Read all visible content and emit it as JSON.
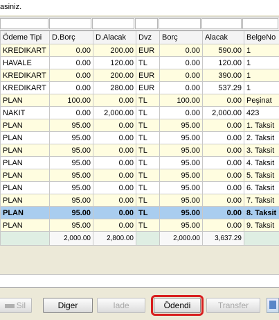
{
  "hint_text": "asiniz.",
  "columns": [
    "Ödeme Tipi",
    "D.Borç",
    "D.Alacak",
    "Dvz",
    "Borç",
    "Alacak",
    "BelgeNo"
  ],
  "rows": [
    {
      "tip": "KREDIKART",
      "dborc": "0.00",
      "dalacak": "200.00",
      "dvz": "EUR",
      "borc": "0.00",
      "alacak": "590.00",
      "belge": "1",
      "style": "y"
    },
    {
      "tip": "HAVALE",
      "dborc": "0.00",
      "dalacak": "120.00",
      "dvz": "TL",
      "borc": "0.00",
      "alacak": "120.00",
      "belge": "1",
      "style": "w"
    },
    {
      "tip": "KREDIKART",
      "dborc": "0.00",
      "dalacak": "200.00",
      "dvz": "EUR",
      "borc": "0.00",
      "alacak": "390.00",
      "belge": "1",
      "style": "y"
    },
    {
      "tip": "KREDIKART",
      "dborc": "0.00",
      "dalacak": "280.00",
      "dvz": "EUR",
      "borc": "0.00",
      "alacak": "537.29",
      "belge": "1",
      "style": "w"
    },
    {
      "tip": "PLAN",
      "dborc": "100.00",
      "dalacak": "0.00",
      "dvz": "TL",
      "borc": "100.00",
      "alacak": "0.00",
      "belge": "Peşinat",
      "style": "y"
    },
    {
      "tip": "NAKIT",
      "dborc": "0.00",
      "dalacak": "2,000.00",
      "dvz": "TL",
      "borc": "0.00",
      "alacak": "2,000.00",
      "belge": "423",
      "style": "w"
    },
    {
      "tip": "PLAN",
      "dborc": "95.00",
      "dalacak": "0.00",
      "dvz": "TL",
      "borc": "95.00",
      "alacak": "0.00",
      "belge": "1. Taksit",
      "style": "y"
    },
    {
      "tip": "PLAN",
      "dborc": "95.00",
      "dalacak": "0.00",
      "dvz": "TL",
      "borc": "95.00",
      "alacak": "0.00",
      "belge": "2. Taksit",
      "style": "w"
    },
    {
      "tip": "PLAN",
      "dborc": "95.00",
      "dalacak": "0.00",
      "dvz": "TL",
      "borc": "95.00",
      "alacak": "0.00",
      "belge": "3. Taksit",
      "style": "y"
    },
    {
      "tip": "PLAN",
      "dborc": "95.00",
      "dalacak": "0.00",
      "dvz": "TL",
      "borc": "95.00",
      "alacak": "0.00",
      "belge": "4. Taksit",
      "style": "w"
    },
    {
      "tip": "PLAN",
      "dborc": "95.00",
      "dalacak": "0.00",
      "dvz": "TL",
      "borc": "95.00",
      "alacak": "0.00",
      "belge": "5. Taksit",
      "style": "y"
    },
    {
      "tip": "PLAN",
      "dborc": "95.00",
      "dalacak": "0.00",
      "dvz": "TL",
      "borc": "95.00",
      "alacak": "0.00",
      "belge": "6. Taksit",
      "style": "w"
    },
    {
      "tip": "PLAN",
      "dborc": "95.00",
      "dalacak": "0.00",
      "dvz": "TL",
      "borc": "95.00",
      "alacak": "0.00",
      "belge": "7. Taksit",
      "style": "y"
    },
    {
      "tip": "PLAN",
      "dborc": "95.00",
      "dalacak": "0.00",
      "dvz": "TL",
      "borc": "95.00",
      "alacak": "0.00",
      "belge": "8. Taksit",
      "style": "sel"
    },
    {
      "tip": "PLAN",
      "dborc": "95.00",
      "dalacak": "0.00",
      "dvz": "TL",
      "borc": "95.00",
      "alacak": "0.00",
      "belge": "9. Taksit",
      "style": "y"
    }
  ],
  "totals": {
    "dborc": "2,000.00",
    "dalacak": "2,800.00",
    "borc": "2,000.00",
    "alacak": "3,637.29"
  },
  "buttons": {
    "sil": "Sil",
    "diger": "Diger",
    "iade": "Iade",
    "odendi": "Ödendi",
    "transfer": "Transfer"
  },
  "colors": {
    "highlight": "#d81f1f",
    "selected_row": "#a9cdef",
    "alt_row": "#fffde0",
    "totals_row": "#dfeee3"
  }
}
